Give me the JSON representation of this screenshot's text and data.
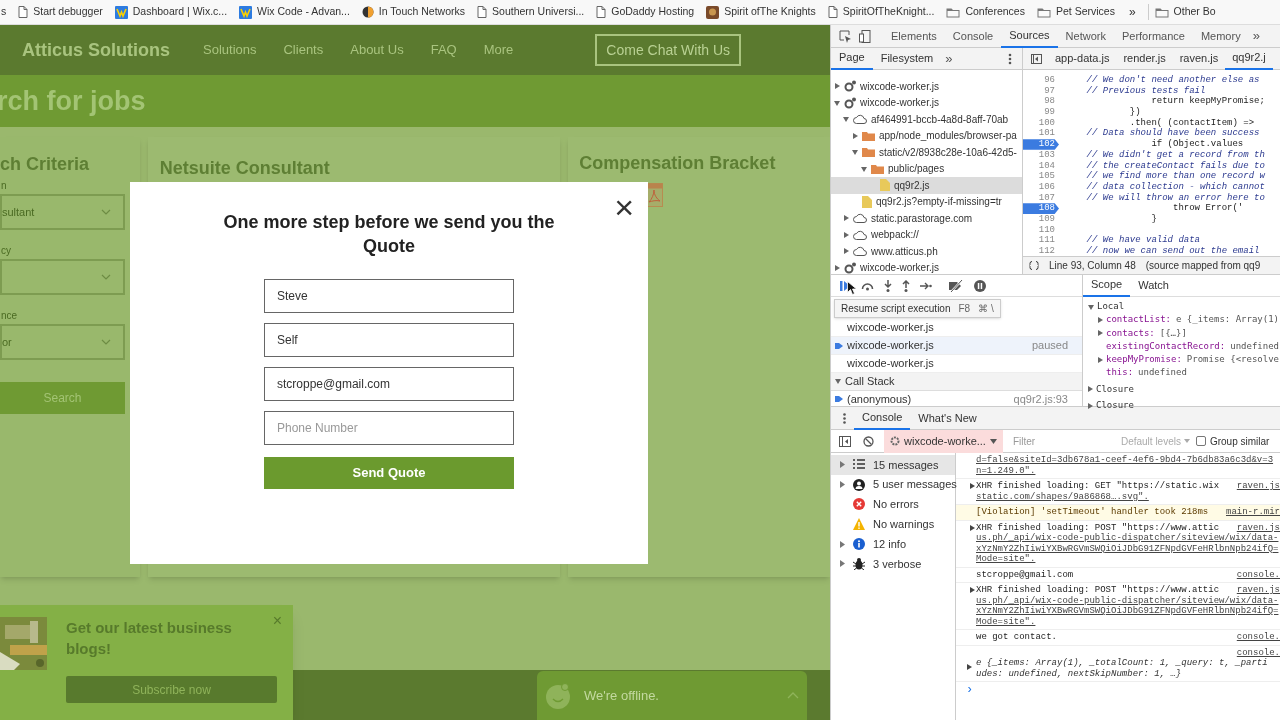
{
  "bookmarks": [
    {
      "label": "s",
      "kind": "none"
    },
    {
      "label": "Start debugger",
      "kind": "page"
    },
    {
      "label": "Dashboard | Wix.c...",
      "kind": "wix"
    },
    {
      "label": "Wix Code - Advan...",
      "kind": "wix"
    },
    {
      "label": "In Touch Networks",
      "kind": "dot"
    },
    {
      "label": "Southern Universi...",
      "kind": "page"
    },
    {
      "label": "GoDaddy Hosting",
      "kind": "page"
    },
    {
      "label": "Spirit ofThe Knights",
      "kind": "badge"
    },
    {
      "label": "SpiritOfTheKnight...",
      "kind": "page"
    },
    {
      "label": "Conferences",
      "kind": "folder"
    },
    {
      "label": "Pet Services",
      "kind": "folder"
    }
  ],
  "bookmarks_overflow": "»",
  "other_bookmarks": "Other Bo",
  "site": {
    "brand": "Atticus Solutions",
    "nav": [
      "Solutions",
      "Clients",
      "About Us",
      "FAQ",
      "More"
    ],
    "chat_button": "Come Chat With Us",
    "banner": "rch for jobs",
    "criteria": {
      "title": "ch Criteria",
      "fields": [
        {
          "label": "n",
          "value": "sultant"
        },
        {
          "label": "cy"
        },
        {
          "label": "nce",
          "value": "or"
        }
      ],
      "search_button": "Search"
    },
    "job_title": "Netsuite Consultant",
    "compensation_title": "Compensation Bracket"
  },
  "modal": {
    "title": "One more step before we send you the Quote",
    "close": "×",
    "fields": [
      {
        "value": "Steve"
      },
      {
        "value": "Self"
      },
      {
        "value": "stcroppe@gmail.com"
      },
      {
        "placeholder": "Phone Number"
      }
    ],
    "submit": "Send Quote"
  },
  "blog_popup": {
    "title": "Get our latest business blogs!",
    "close": "×",
    "button": "Subscribe now"
  },
  "chat_widget": {
    "status": "We're offline."
  },
  "devtools": {
    "tabs": [
      {
        "label": "Elements",
        "selected": false
      },
      {
        "label": "Console",
        "selected": false
      },
      {
        "label": "Sources",
        "selected": true
      },
      {
        "label": "Network",
        "selected": false
      },
      {
        "label": "Performance",
        "selected": false
      },
      {
        "label": "Memory",
        "selected": false
      }
    ],
    "tabs_overflow": "»",
    "navigator_tabs": [
      {
        "label": "Page",
        "selected": true
      },
      {
        "label": "Filesystem",
        "selected": false
      }
    ],
    "navigator_overflow": "»",
    "tree": [
      {
        "label": "wixcode-worker.js",
        "kind": "worker",
        "expanded": false,
        "selected": false
      },
      {
        "label": "wixcode-worker.js",
        "kind": "worker",
        "expanded": true,
        "selected": false,
        "children": [
          {
            "label": "af464991-bccb-4a8d-8aff-70ab",
            "kind": "domain",
            "expanded": true,
            "selected": false,
            "children": [
              {
                "label": "app/node_modules/browser-pa",
                "kind": "folder",
                "expanded": false,
                "selected": false
              },
              {
                "label": "static/v2/8938c28e-10a6-42d5-",
                "kind": "folder",
                "expanded": true,
                "selected": false,
                "children": [
                  {
                    "label": "public/pages",
                    "kind": "folder",
                    "expanded": true,
                    "selected": false,
                    "children": [
                      {
                        "label": "qq9r2.js",
                        "kind": "file",
                        "selected": true
                      }
                    ]
                  }
                ]
              },
              {
                "label": "qq9r2.js?empty-if-missing=tr",
                "kind": "file",
                "selected": false
              }
            ]
          },
          {
            "label": "static.parastorage.com",
            "kind": "domain",
            "expanded": false,
            "selected": false
          },
          {
            "label": "webpack://",
            "kind": "domain",
            "expanded": false,
            "selected": false
          },
          {
            "label": "www.atticus.ph",
            "kind": "domain",
            "expanded": false,
            "selected": false
          }
        ]
      },
      {
        "label": "wixcode-worker.js",
        "kind": "worker",
        "expanded": false,
        "selected": false
      }
    ],
    "editor_tabs": [
      {
        "label": "app-data.js",
        "selected": false
      },
      {
        "label": "render.js",
        "selected": false
      },
      {
        "label": "raven.js",
        "selected": false
      },
      {
        "label": "qq9r2.j",
        "selected": true
      }
    ],
    "code": [
      {
        "number": "96",
        "kind": "comment",
        "text": "    // We don't need another else as",
        "breakpoint": false
      },
      {
        "number": "97",
        "kind": "comment",
        "text": "    // Previous tests fail",
        "breakpoint": false
      },
      {
        "number": "98",
        "kind": "code",
        "text": "                return keepMyPromise;",
        "breakpoint": false
      },
      {
        "number": "99",
        "kind": "code",
        "text": "            })",
        "breakpoint": false
      },
      {
        "number": "100",
        "kind": "code",
        "text": "            .then( (contactItem) =>",
        "breakpoint": false
      },
      {
        "number": "101",
        "kind": "comment",
        "text": "    // Data should have been success",
        "breakpoint": false
      },
      {
        "number": "102",
        "kind": "code",
        "text": "                if (Object.values",
        "breakpoint": true
      },
      {
        "number": "103",
        "kind": "comment",
        "text": "    // We didn't get a record from th",
        "breakpoint": false
      },
      {
        "number": "104",
        "kind": "comment",
        "text": "    // the createContact fails due to",
        "breakpoint": false
      },
      {
        "number": "105",
        "kind": "comment",
        "text": "    // we find more than one record w",
        "breakpoint": false
      },
      {
        "number": "106",
        "kind": "comment",
        "text": "    // data collection - which cannot",
        "breakpoint": false
      },
      {
        "number": "107",
        "kind": "comment",
        "text": "    // We will throw an error here to",
        "breakpoint": false
      },
      {
        "number": "108",
        "kind": "code",
        "text": "                    throw Error('",
        "breakpoint": true
      },
      {
        "number": "109",
        "kind": "code",
        "text": "                }",
        "breakpoint": false
      },
      {
        "number": "110",
        "breakpoint": false
      },
      {
        "number": "111",
        "kind": "comment",
        "text": "    // We have valid data",
        "breakpoint": false
      },
      {
        "number": "112",
        "kind": "comment",
        "text": "    // now we can send out the email",
        "breakpoint": false
      }
    ],
    "position": "Line 93, Column 48",
    "source_map": "(source mapped from qq9",
    "tooltip": {
      "label": "Resume script execution",
      "key": "F8",
      "shortcut": "⌘ \\"
    },
    "threads": [
      {
        "label": "wixcode-worker.js",
        "selected": false
      },
      {
        "label": "wixcode-worker.js",
        "selected": true,
        "status": "paused"
      },
      {
        "label": "wixcode-worker.js",
        "selected": false
      }
    ],
    "call_stack": {
      "title": "Call Stack",
      "expanded": true,
      "frames": [
        {
          "name": "(anonymous)",
          "location": "qq9r2.js:93",
          "selected": true
        }
      ]
    },
    "scope_tabs": [
      {
        "label": "Scope",
        "selected": true
      },
      {
        "label": "Watch",
        "selected": false
      }
    ],
    "scope": {
      "title": "Local",
      "vars": [
        {
          "name": "contactList:",
          "value": "e {_items: Array(1)",
          "expandable": true
        },
        {
          "name": "contacts:",
          "value": "[{…}]",
          "expandable": true
        },
        {
          "name": "existingContactRecord:",
          "value": "undefined",
          "expandable": false
        },
        {
          "name": "keepMyPromise:",
          "value": "Promise {<resolve",
          "expandable": true
        },
        {
          "name": "this:",
          "value": "undefined",
          "expandable": false
        }
      ],
      "closures": [
        "Closure",
        "Closure"
      ]
    },
    "drawer_tabs": [
      {
        "label": "Console",
        "selected": true
      },
      {
        "label": "What's New",
        "selected": false
      }
    ],
    "context": "wixcode-worke...",
    "filter_placeholder": "Filter",
    "levels": "Default levels",
    "group_similar": {
      "label": "Group similar",
      "checked": false
    },
    "sidebar": [
      {
        "label": "15 messages",
        "kind": "list",
        "expandable": true,
        "selected": true
      },
      {
        "label": "5 user messages",
        "kind": "user",
        "expandable": true,
        "selected": false
      },
      {
        "label": "No errors",
        "kind": "error",
        "expandable": false,
        "selected": false
      },
      {
        "label": "No warnings",
        "kind": "warning",
        "expandable": false,
        "selected": false
      },
      {
        "label": "12 info",
        "kind": "info",
        "expandable": true,
        "selected": false
      },
      {
        "label": "3 verbose",
        "kind": "verbose",
        "expandable": true,
        "selected": false
      }
    ],
    "messages": [
      {
        "kind": "log",
        "lines": [
          "d=false&siteId=3db678a1-ceef-4ef6-9bd4-7b6db83a6c3d&v=3",
          "n=1.249.0\"."
        ]
      },
      {
        "kind": "xhr",
        "lines": [
          "XHR finished loading: GET \"https://static.wix",
          "static.com/shapes/9a86868….svg\"."
        ],
        "source": "raven.js"
      },
      {
        "kind": "violation",
        "lines": [
          "[Violation] 'setTimeout' handler took 218ms"
        ],
        "source": "main-r.mir"
      },
      {
        "kind": "xhr",
        "lines": [
          "XHR finished loading: POST \"https://www.attic",
          "us.ph/_api/wix-code-public-dispatcher/siteview/wix/data-",
          "xYzNmY2ZhIiwiYXBwRGVmSWQiOiJDbG91ZFNpdGVFeHRlbnNpb24ifQ=",
          "Mode=site\"."
        ],
        "source": "raven.js"
      },
      {
        "kind": "log",
        "lines": [
          "stcroppe@gmail.com"
        ],
        "source": "console."
      },
      {
        "kind": "xhr",
        "lines": [
          "XHR finished loading: POST \"https://www.attic",
          "us.ph/_api/wix-code-public-dispatcher/siteview/wix/data-",
          "xYzNmY2ZhIiwiYXBwRGVmSWQiOiJDbG91ZFNpdGVFeHRlbnNpb24ifQ=",
          "Mode=site\"."
        ],
        "source": "raven.js"
      },
      {
        "kind": "log",
        "lines": [
          "we got contact."
        ],
        "source": "console."
      },
      {
        "kind": "object",
        "lines": [
          "e {_items: Array(1), _totalCount: 1, _query: t, _parti",
          "udes: undefined, nextSkipNumber: 1, …}"
        ],
        "source": "console."
      }
    ],
    "prompt": "›"
  }
}
